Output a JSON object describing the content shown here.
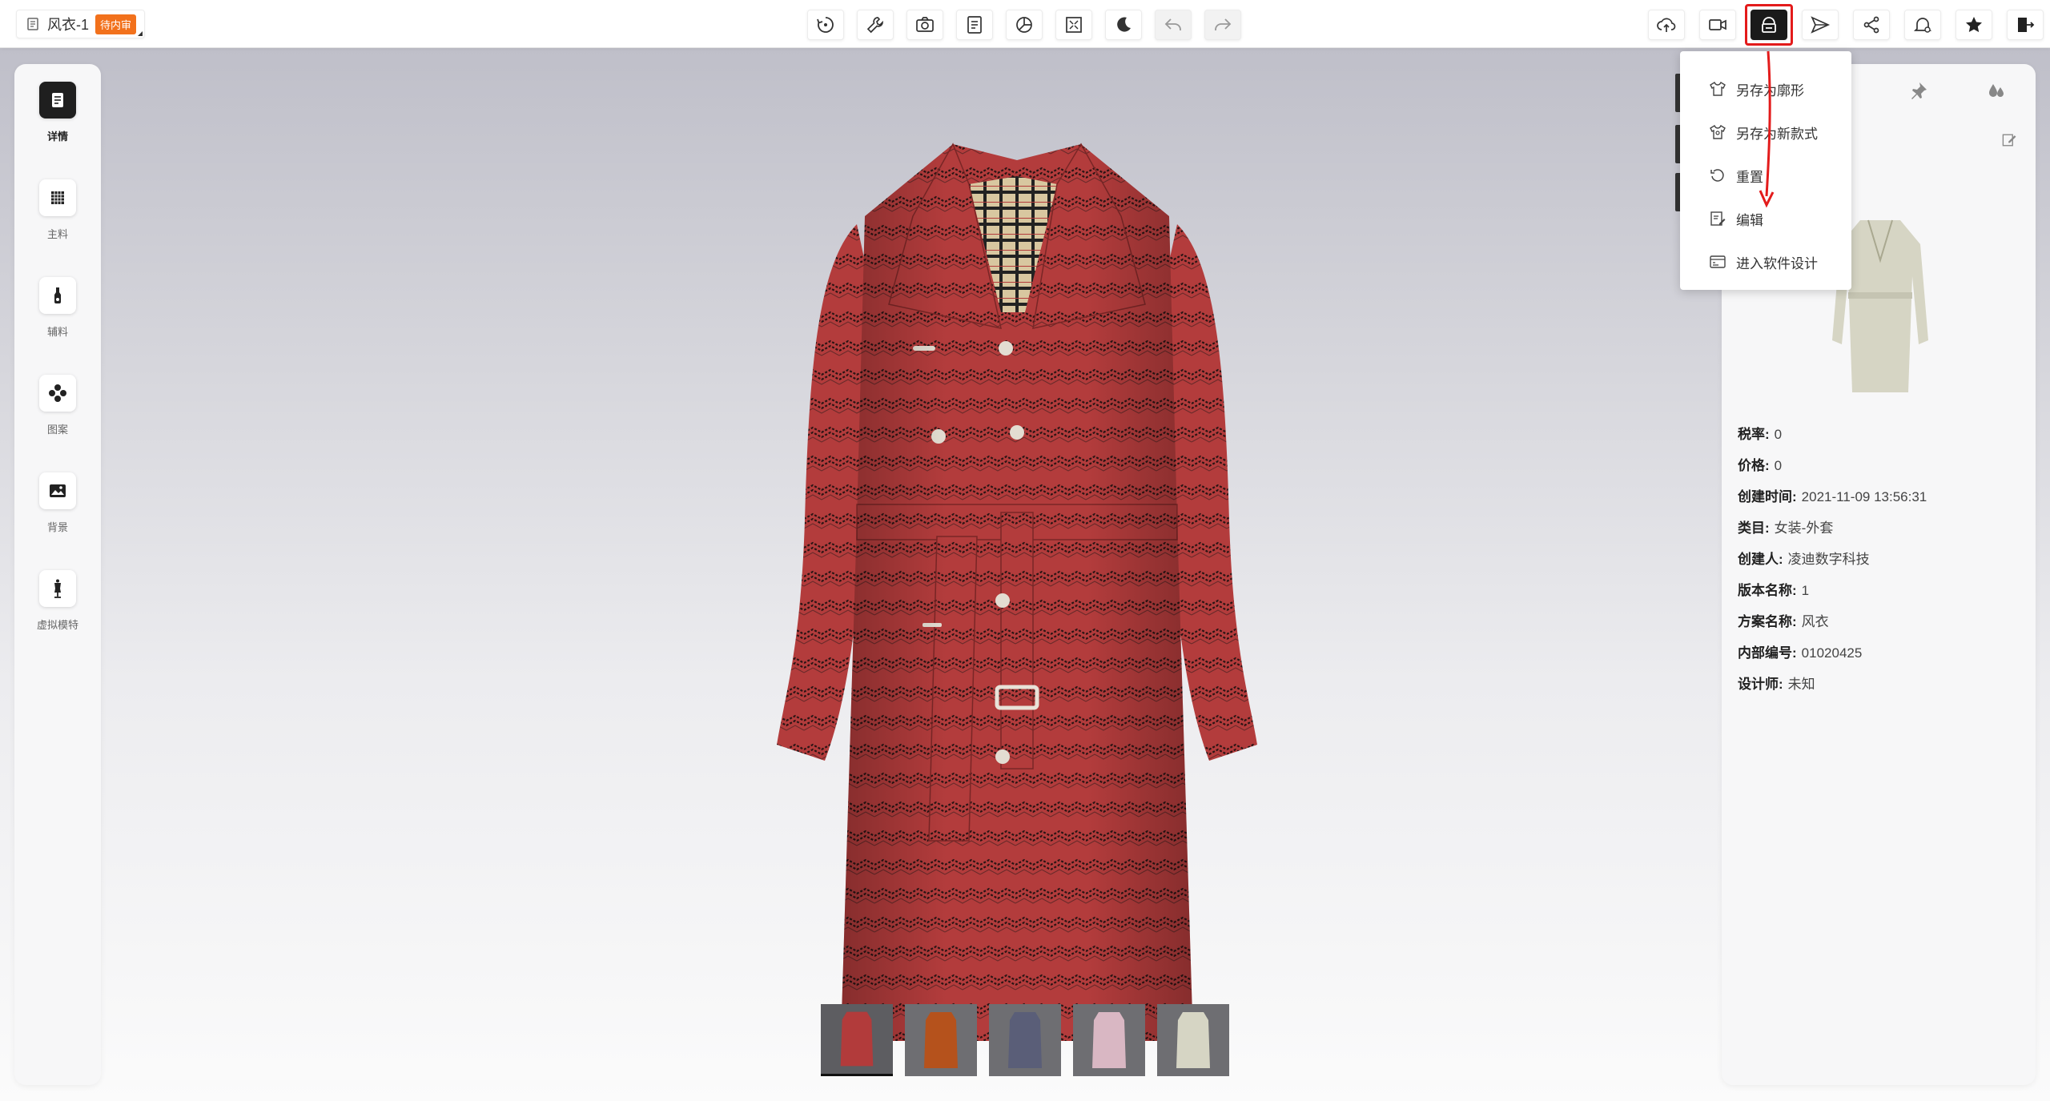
{
  "document": {
    "title": "风衣-1",
    "status_badge": "待内审"
  },
  "toolbar": {
    "center_buttons": [
      {
        "name": "rotate-icon",
        "interactable": true
      },
      {
        "name": "wrench-icon",
        "interactable": true
      },
      {
        "name": "camera-icon",
        "interactable": true
      },
      {
        "name": "document-icon",
        "interactable": true
      },
      {
        "name": "pie-chart-icon",
        "interactable": true
      },
      {
        "name": "fullscreen-icon",
        "interactable": true
      },
      {
        "name": "moon-icon",
        "interactable": true
      },
      {
        "name": "undo-icon",
        "interactable": true
      },
      {
        "name": "redo-icon",
        "interactable": true
      }
    ],
    "right_buttons": [
      {
        "name": "cloud-upload-icon"
      },
      {
        "name": "video-icon"
      },
      {
        "name": "save-icon"
      },
      {
        "name": "send-icon"
      },
      {
        "name": "share-icon"
      },
      {
        "name": "bell-settings-icon"
      },
      {
        "name": "star-icon"
      },
      {
        "name": "exit-icon"
      }
    ]
  },
  "left_sidebar": {
    "items": [
      {
        "label": "详情",
        "icon": "document-icon",
        "active": true
      },
      {
        "label": "主料",
        "icon": "grid-fabric-icon",
        "active": false
      },
      {
        "label": "辅料",
        "icon": "zipper-icon",
        "active": false
      },
      {
        "label": "图案",
        "icon": "pattern-flower-icon",
        "active": false
      },
      {
        "label": "背景",
        "icon": "image-icon",
        "active": false
      },
      {
        "label": "虚拟模特",
        "icon": "mannequin-icon",
        "active": false
      }
    ]
  },
  "save_menu": {
    "items": [
      {
        "label": "另存为廓形",
        "icon": "tshirt-icon"
      },
      {
        "label": "另存为新款式",
        "icon": "tshirt-icon"
      },
      {
        "label": "重置",
        "icon": "reset-icon"
      },
      {
        "label": "编辑",
        "icon": "edit-icon"
      },
      {
        "label": "进入软件设计",
        "icon": "software-icon"
      }
    ]
  },
  "details": {
    "rows": [
      {
        "key": "税率:",
        "value": "0"
      },
      {
        "key": "价格:",
        "value": "0"
      },
      {
        "key": "创建时间:",
        "value": "2021-11-09 13:56:31"
      },
      {
        "key": "类目:",
        "value": "女装-外套"
      },
      {
        "key": "创建人:",
        "value": "凌迪数字科技"
      },
      {
        "key": "版本名称:",
        "value": "1"
      },
      {
        "key": "方案名称:",
        "value": "风衣"
      },
      {
        "key": "内部编号:",
        "value": "01020425"
      },
      {
        "key": "设计师:",
        "value": "未知"
      }
    ]
  },
  "colorways": [
    {
      "color": "#b23b3b"
    },
    {
      "color": "#b5521c"
    },
    {
      "color": "#5a5e78"
    },
    {
      "color": "#d9b7c3"
    },
    {
      "color": "#d6d5c4"
    }
  ],
  "colors": {
    "coat": "#b33c3c",
    "badge": "#f2711c",
    "highlight": "#e31b1b"
  }
}
